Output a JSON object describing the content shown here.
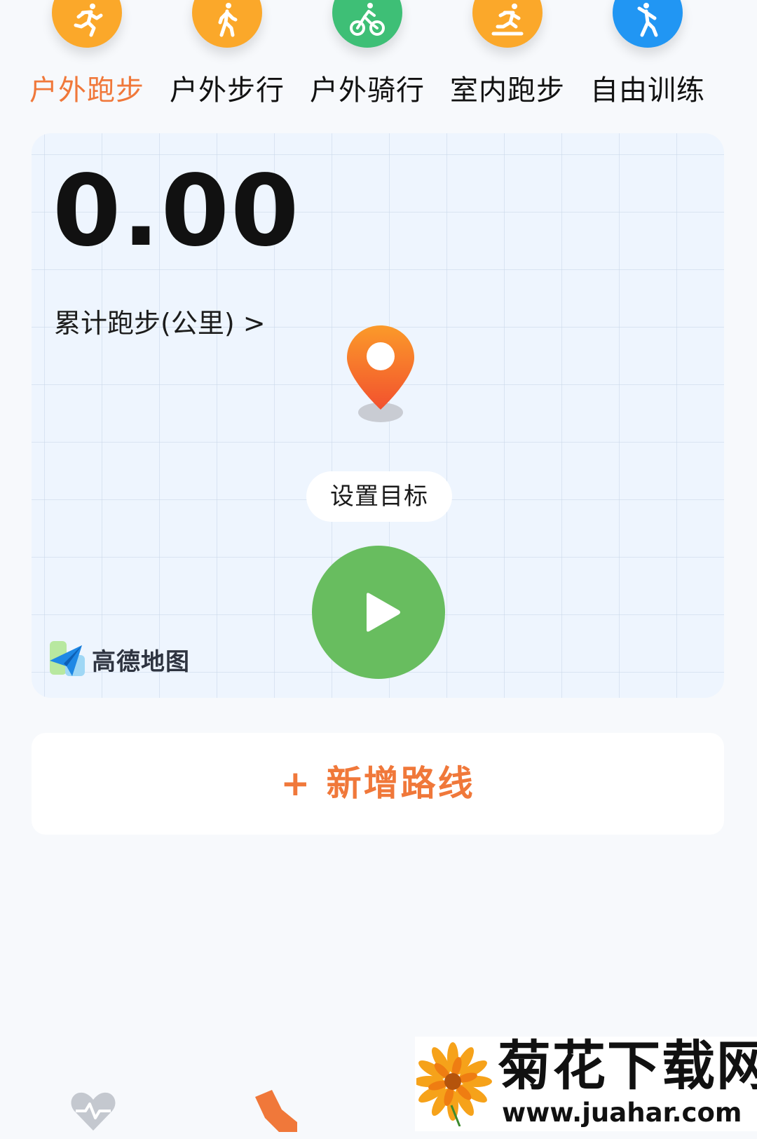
{
  "tabs": [
    {
      "label": "户外跑步",
      "color": "#fba82a",
      "icon": "runner-icon",
      "active": true
    },
    {
      "label": "户外步行",
      "color": "#fba82a",
      "icon": "walker-icon",
      "active": false
    },
    {
      "label": "户外骑行",
      "color": "#3ebf76",
      "icon": "cyclist-icon",
      "active": false
    },
    {
      "label": "室内跑步",
      "color": "#fba82a",
      "icon": "treadmill-runner-icon",
      "active": false
    },
    {
      "label": "自由训练",
      "color": "#2196f3",
      "icon": "free-training-icon",
      "active": false
    }
  ],
  "map": {
    "distance_value": "0.00",
    "distance_label": "累计跑步(公里) >",
    "set_goal_label": "设置目标",
    "start_icon": "play-icon",
    "map_provider": "高德地图"
  },
  "add_route": {
    "label": "+ 新增路线"
  },
  "bottom_nav": [
    {
      "icon": "heart-pulse-icon"
    },
    {
      "icon": "shoe-icon"
    }
  ],
  "watermark": {
    "title": "菊花下载网",
    "url": "www.juahar.com"
  },
  "colors": {
    "accent": "#f0783a",
    "start_button": "#68bd5f",
    "map_background": "#eef5fe",
    "page_background": "#f7f9fc"
  }
}
